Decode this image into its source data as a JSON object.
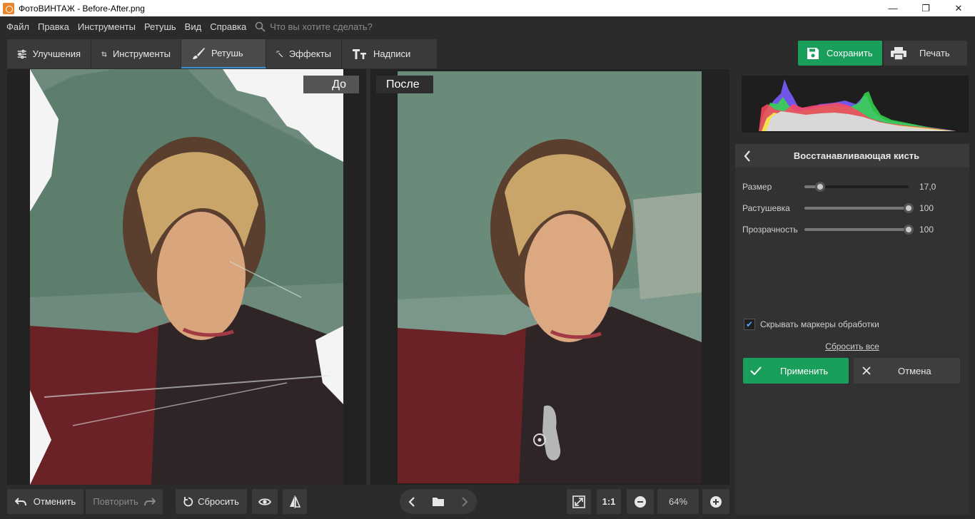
{
  "window": {
    "title": "ФотоВИНТАЖ - Before-After.png",
    "minimize": "—",
    "maximize": "❐",
    "close": "✕"
  },
  "menu": {
    "items": [
      "Файл",
      "Правка",
      "Инструменты",
      "Ретушь",
      "Вид",
      "Справка"
    ],
    "search_placeholder": "Что вы хотите сделать?"
  },
  "tabs": [
    {
      "label": "Улучшения",
      "icon": "sliders-icon"
    },
    {
      "label": "Инструменты",
      "icon": "crop-icon"
    },
    {
      "label": "Ретушь",
      "icon": "brush-icon",
      "active": true
    },
    {
      "label": "Эффекты",
      "icon": "magic-wand-icon"
    },
    {
      "label": "Надписи",
      "icon": "text-icon"
    }
  ],
  "actions": {
    "save": "Сохранить",
    "print": "Печать"
  },
  "canvas": {
    "before_label": "До",
    "after_label": "После"
  },
  "bottom": {
    "undo": "Отменить",
    "redo": "Повторить",
    "reset": "Сбросить",
    "one_to_one": "1:1",
    "zoom": "64%"
  },
  "panel": {
    "title": "Восстанавливающая кисть",
    "sliders": [
      {
        "label": "Размер",
        "value": "17,0",
        "level": 0.15
      },
      {
        "label": "Растушевка",
        "value": "100",
        "level": 1.0
      },
      {
        "label": "Прозрачность",
        "value": "100",
        "level": 1.0
      }
    ],
    "checkbox_label": "Скрывать маркеры обработки",
    "checkbox_checked": true,
    "reset_all": "Сбросить все",
    "apply": "Применить",
    "cancel": "Отмена"
  },
  "colors": {
    "accent_green": "#1a9e5b",
    "active_tab_underline": "#3d8fd6"
  }
}
